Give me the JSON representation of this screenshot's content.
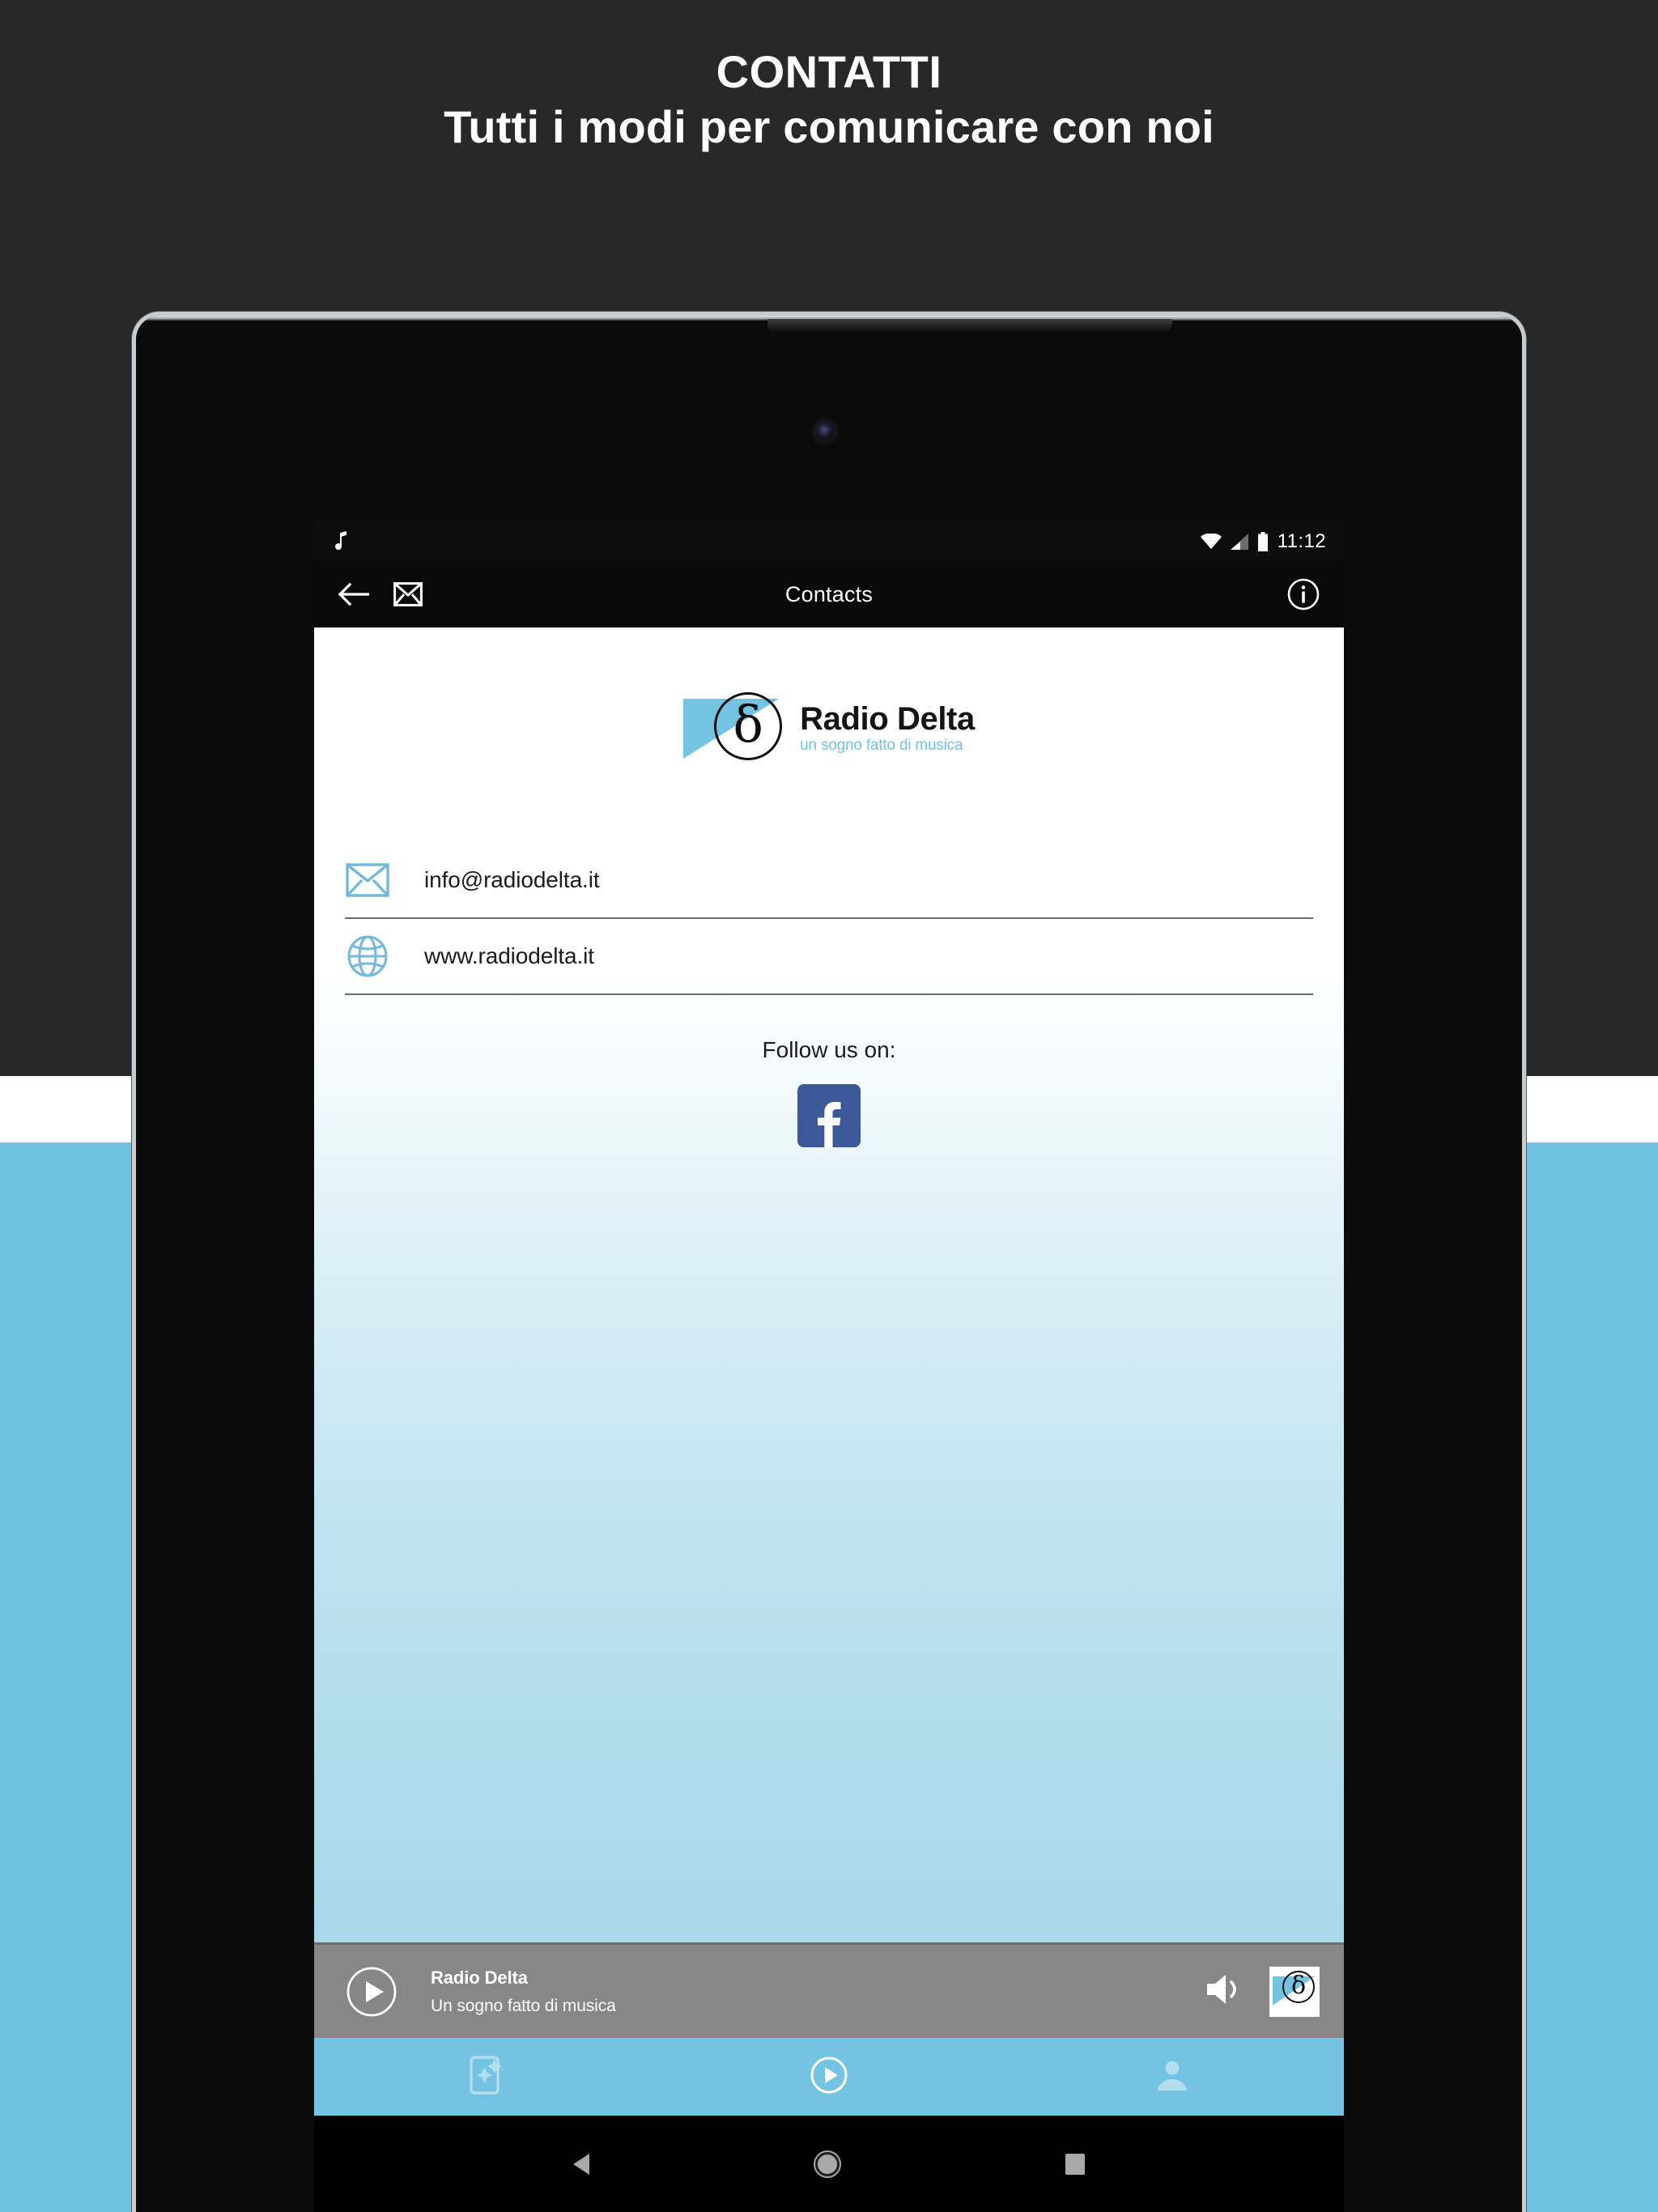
{
  "promo": {
    "title": "CONTATTI",
    "subtitle": "Tutti i modi per comunicare con noi",
    "bg_dark": "#282828",
    "bg_blue": "#6fc3e0",
    "text_color": "#ffffff"
  },
  "status_bar": {
    "music_icon": "music-note-icon",
    "wifi_icon": "wifi-icon",
    "signal_icon": "cellular-signal-icon",
    "battery_icon": "battery-icon",
    "time": "11:12"
  },
  "toolbar": {
    "back_icon": "arrow-back-icon",
    "mail_icon": "envelope-icon",
    "title": "Contacts",
    "info_icon": "info-circle-icon"
  },
  "logo": {
    "symbol": "δ",
    "name": "Radio Delta",
    "tagline": "un sogno fatto di musica",
    "accent": "#74c3e2"
  },
  "contacts": [
    {
      "icon": "envelope-icon",
      "label": "info@radiodelta.it"
    },
    {
      "icon": "globe-icon",
      "label": "www.radiodelta.it"
    }
  ],
  "follow": {
    "label": "Follow us on:",
    "facebook_icon": "facebook-icon",
    "facebook_color": "#3b5998",
    "facebook_glyph": "f"
  },
  "player": {
    "play_icon": "play-circle-icon",
    "title": "Radio Delta",
    "subtitle": "Un sogno fatto di musica",
    "volume_icon": "volume-up-icon",
    "thumb_icon": "radio-delta-logo-thumb",
    "thumb_symbol": "δ",
    "bar_color": "#878787"
  },
  "bottom_nav": [
    {
      "icon": "news-article-icon",
      "active": false
    },
    {
      "icon": "play-circle-icon",
      "active": true
    },
    {
      "icon": "account-person-icon",
      "active": false
    }
  ],
  "android_nav": {
    "back_icon": "android-back-icon",
    "home_icon": "android-home-icon",
    "recents_icon": "android-recents-icon"
  }
}
